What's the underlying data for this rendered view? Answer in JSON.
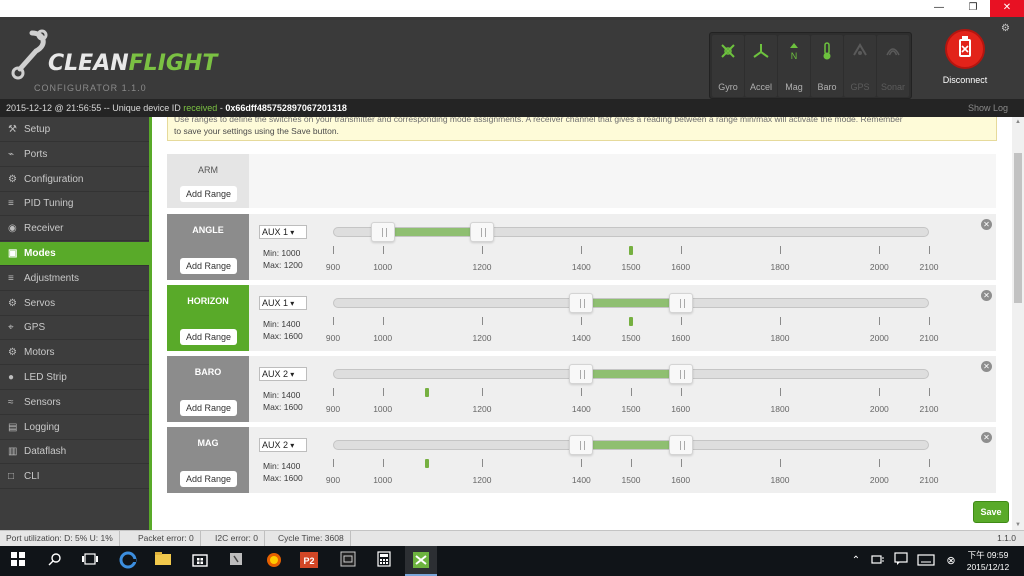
{
  "app": {
    "logo_name_main": "CLEAN",
    "logo_name_accent": "FLIGHT",
    "logo_subtitle": "CONFIGURATOR 1.1.0",
    "disconnect_label": "Disconnect"
  },
  "sensors": [
    {
      "name": "Gyro",
      "icon": "gyro-icon",
      "active": true
    },
    {
      "name": "Accel",
      "icon": "accel-icon",
      "active": true
    },
    {
      "name": "Mag",
      "icon": "mag-icon",
      "active": true
    },
    {
      "name": "Baro",
      "icon": "baro-icon",
      "active": true
    },
    {
      "name": "GPS",
      "icon": "gps-icon",
      "active": false
    },
    {
      "name": "Sonar",
      "icon": "sonar-icon",
      "active": false
    }
  ],
  "statusline": {
    "prefix": "2015-12-12 @ 21:56:55 -- Unique device ID",
    "state": "received",
    "sep": "-",
    "device_id": "0x66dff485752897067201318",
    "show_log": "Show Log"
  },
  "sidebar": {
    "items": [
      {
        "label": "Setup",
        "icon": "wrench-icon"
      },
      {
        "label": "Ports",
        "icon": "plug-icon"
      },
      {
        "label": "Configuration",
        "icon": "gear-icon"
      },
      {
        "label": "PID Tuning",
        "icon": "sliders-icon"
      },
      {
        "label": "Receiver",
        "icon": "receiver-icon"
      },
      {
        "label": "Modes",
        "icon": "modes-icon"
      },
      {
        "label": "Adjustments",
        "icon": "adjust-icon"
      },
      {
        "label": "Servos",
        "icon": "servo-icon"
      },
      {
        "label": "GPS",
        "icon": "gps-icon"
      },
      {
        "label": "Motors",
        "icon": "motor-icon"
      },
      {
        "label": "LED Strip",
        "icon": "led-icon"
      },
      {
        "label": "Sensors",
        "icon": "sensors-icon"
      },
      {
        "label": "Logging",
        "icon": "logging-icon"
      },
      {
        "label": "Dataflash",
        "icon": "dataflash-icon"
      },
      {
        "label": "CLI",
        "icon": "cli-icon"
      }
    ],
    "active_index": 5
  },
  "note": {
    "line1": "Use ranges to define the switches on your transmitter and corresponding mode assignments. A receiver channel that gives a reading between a range min/max will activate the mode. Remember",
    "line2": "to save your settings using the Save button."
  },
  "scale_ticks": [
    "900",
    "1000",
    "1200",
    "1400",
    "1500",
    "1600",
    "1800",
    "2000",
    "2100"
  ],
  "add_range_label": "Add Range",
  "modes": [
    {
      "name": "ARM",
      "has_range": false
    },
    {
      "name": "ANGLE",
      "has_range": true,
      "active": false,
      "aux": "AUX 1",
      "min": "Min: 1000",
      "max": "Max: 1200",
      "range_min": 1000,
      "range_max": 1200,
      "channel_value": 1500
    },
    {
      "name": "HORIZON",
      "has_range": true,
      "active": true,
      "aux": "AUX 1",
      "min": "Min: 1400",
      "max": "Max: 1600",
      "range_min": 1400,
      "range_max": 1600,
      "channel_value": 1500
    },
    {
      "name": "BARO",
      "has_range": true,
      "active": false,
      "aux": "AUX 2",
      "min": "Min: 1400",
      "max": "Max: 1600",
      "range_min": 1400,
      "range_max": 1600,
      "channel_value": 1090
    },
    {
      "name": "MAG",
      "has_range": true,
      "active": false,
      "aux": "AUX 2",
      "min": "Min: 1400",
      "max": "Max: 1600",
      "range_min": 1400,
      "range_max": 1600,
      "channel_value": 1090
    }
  ],
  "save_label": "Save",
  "statusbar": {
    "port_util": "Port utilization: D: 5% U: 1%",
    "packet_error": "Packet error: 0",
    "i2c_error": "I2C error: 0",
    "cycle_time": "Cycle Time: 3608",
    "version": "1.1.0"
  },
  "taskbar": {
    "clock_time": "下午 09:59",
    "clock_date": "2015/12/12"
  }
}
